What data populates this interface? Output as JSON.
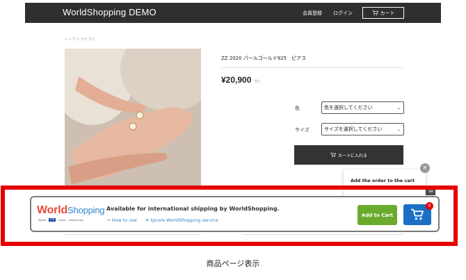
{
  "header": {
    "brand": "WorldShopping DEMO",
    "member_register": "会員登録",
    "login": "ログイン",
    "cart": "カート"
  },
  "breadcrumb": "トップ ＞ カテゴリ",
  "product": {
    "title": "ZZ 2020 パールゴールド925　ピアス",
    "price": "¥20,900",
    "tax_note": "税込",
    "color_label": "色",
    "color_select": "色を選択してください",
    "size_label": "サイズ",
    "size_select": "サイズを選択してください",
    "add_to_cart": "カートに入れる"
  },
  "tooltip": {
    "text": "Add the order to the cart",
    "close_symbol": "×",
    "close_tab": "se"
  },
  "banner": {
    "logo_world": "World",
    "logo_shopping": "Shopping",
    "payments": [
      "PayPal",
      "JCB",
      "Alipay",
      "amazon pay"
    ],
    "title": "Available for international shipping by WorldShopping.",
    "how_to_use": "→ How to use",
    "ignore": "✕ Ignore WorldShopping service",
    "add_to_cart": "Add to Cart",
    "cart_count": "0"
  },
  "caption": "商品ページ表示",
  "colors": {
    "header_bg": "#2f2f2f",
    "highlight_red": "#e60000",
    "add_green": "#6aab2e",
    "cart_blue": "#1b6fc4",
    "link_blue": "#2f86c8"
  }
}
